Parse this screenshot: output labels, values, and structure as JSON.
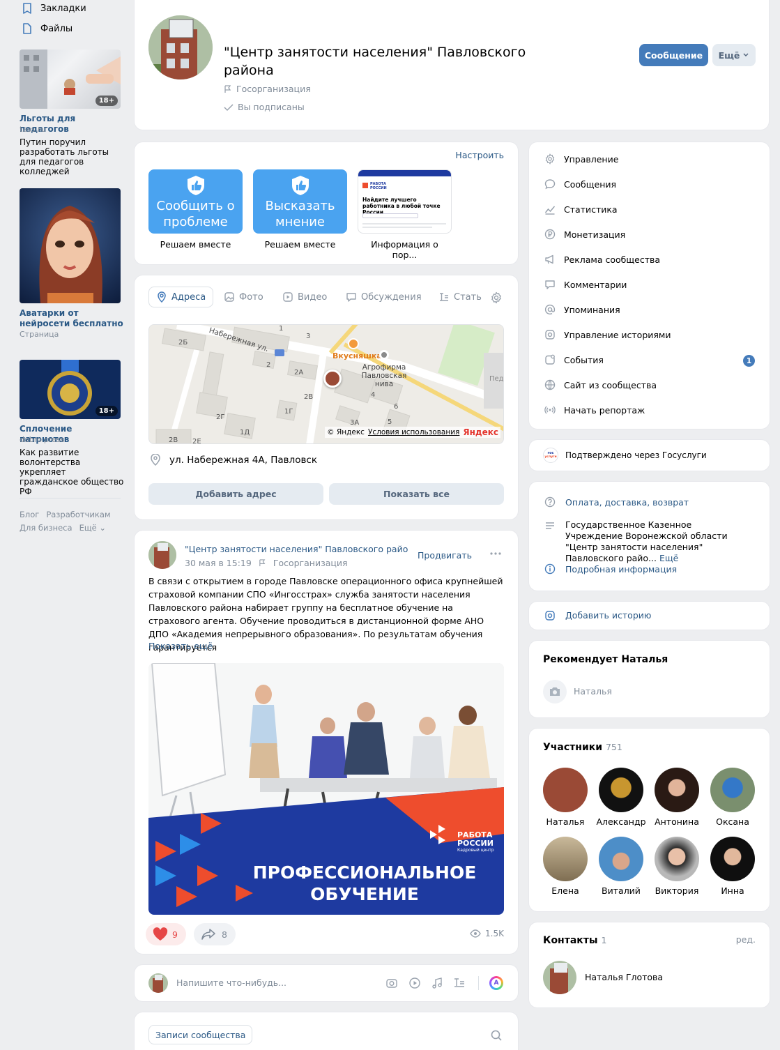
{
  "left_nav": {
    "bookmarks": "Закладки",
    "files": "Файлы"
  },
  "promos": [
    {
      "title": "Льготы для педагогов",
      "source": "tass.ru",
      "desc": "Путин поручил разработать льготы для педагогов колледжей",
      "badge": "18+"
    },
    {
      "title": "Аватарки от нейросети бесплатно",
      "source": "Страница",
      "desc": "",
      "badge": ""
    },
    {
      "title": "Сплочение патриотов",
      "source": "dobro.press",
      "desc": "Как развитие волонтерства укрепляет гражданское общество РФ",
      "badge": "18+"
    }
  ],
  "footer_links": {
    "blog": "Блог",
    "dev": "Разработчикам",
    "business": "Для бизнеса",
    "more": "Ещё"
  },
  "header": {
    "title": "\"Центр занятости населения\" Павловского района",
    "type": "Госорганизация",
    "subscribed": "Вы подписаны",
    "message_btn": "Сообщение",
    "more_btn": "Ещё"
  },
  "widgets": {
    "configure": "Настроить",
    "items": [
      {
        "tile": "Сообщить о проблеме",
        "caption": "Решаем вместе"
      },
      {
        "tile": "Высказать мнение",
        "caption": "Решаем вместе"
      },
      {
        "tile": "Найдите лучшего работника в любой точке России",
        "caption": "Информация о пор..."
      }
    ],
    "rr_logo": "РАБОТА РОССИИ"
  },
  "tabs": [
    "Адреса",
    "Фото",
    "Видео",
    "Обсуждения",
    "Стать"
  ],
  "map": {
    "street": "Набережная ул.",
    "poi1": "Вкусняшка",
    "poi2": "Агрофирма Павловская нива",
    "edge": "Пед",
    "copyright": "© Яндекс",
    "terms": "Условия использования",
    "brand": "Яндекс",
    "buildings": [
      "2Б",
      "1",
      "3",
      "2",
      "2А",
      "2В",
      "1Г",
      "4",
      "6",
      "2Г",
      "1Д",
      "3А",
      "5",
      "2В",
      "2Е"
    ]
  },
  "address": {
    "text": "ул. Набережная 4А, Павловск",
    "add_btn": "Добавить адрес",
    "show_all_btn": "Показать все"
  },
  "post": {
    "author": "\"Центр занятости населения\" Павловского района",
    "date": "30 мая в 15:19",
    "type": "Госорганизация",
    "promote": "Продвигать",
    "text": "В связи с открытием в городе Павловске операционного офиса крупнейшей страховой компании СПО «Ингосстрах» служба занятости населения Павловского района набирает группу на бесплатное обучение на страхового агента. Обучение проводиться в дистанционной форме АНО ДПО «Академия непрерывного образования». По результатам обучения гарантируется",
    "show_more": "Показать ещё",
    "banner_line1": "ПРОФЕССИОНАЛЬНОЕ",
    "banner_line2": "ОБУЧЕНИЕ",
    "banner_logo1": "РАБОТА",
    "banner_logo2": "РОССИИ",
    "banner_logo_sub": "Кадровый центр",
    "likes": "9",
    "shares": "8",
    "views": "1.5K"
  },
  "composer": {
    "placeholder": "Напишите что-нибудь..."
  },
  "community_posts": {
    "label": "Записи сообщества"
  },
  "management": [
    {
      "label": "Управление",
      "icon": "gear-icon"
    },
    {
      "label": "Сообщения",
      "icon": "chat-icon"
    },
    {
      "label": "Статистика",
      "icon": "stats-icon"
    },
    {
      "label": "Монетизация",
      "icon": "ruble-icon"
    },
    {
      "label": "Реклама сообщества",
      "icon": "megaphone-icon"
    },
    {
      "label": "Комментарии",
      "icon": "comment-icon"
    },
    {
      "label": "Упоминания",
      "icon": "at-icon"
    },
    {
      "label": "Управление историями",
      "icon": "story-icon"
    },
    {
      "label": "События",
      "icon": "event-icon"
    },
    {
      "label": "Сайт из сообщества",
      "icon": "globe-icon"
    },
    {
      "label": "Начать репортаж",
      "icon": "broadcast-icon"
    }
  ],
  "events_count": "1",
  "gosuslugi": {
    "text": "Подтверждено через Госуслуги",
    "logo1": "гос",
    "logo2": "услуги"
  },
  "info": {
    "payment": "Оплата, доставка, возврат",
    "description": "Государственное Казенное Учреждение Воронежской области \"Центр занятости населения\" Павловского райо...",
    "more": "Ещё",
    "details": "Подробная информация"
  },
  "add_story": "Добавить историю",
  "recommends": {
    "title": "Рекомендует Наталья",
    "name": "Наталья"
  },
  "members": {
    "title": "Участники",
    "count": "751",
    "list": [
      "Наталья",
      "Александр",
      "Антонина",
      "Оксана",
      "Елена",
      "Виталий",
      "Виктория",
      "Инна"
    ]
  },
  "contacts": {
    "title": "Контакты",
    "count": "1",
    "edit": "ред.",
    "name": "Наталья Глотова"
  },
  "colors": {
    "accent": "#447bba",
    "link": "#2a5885",
    "like": "#e64646",
    "rr_red": "#ee4d2d",
    "rr_blue": "#1e3aa0"
  }
}
